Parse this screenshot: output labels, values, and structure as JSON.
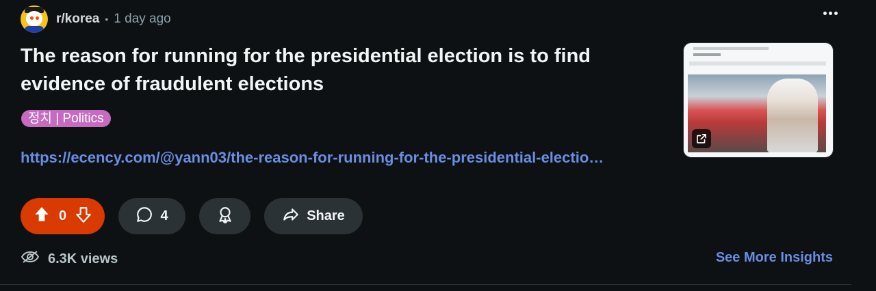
{
  "post": {
    "subreddit": "r/korea",
    "separator": "•",
    "time": "1 day ago",
    "title": "The reason for running for the presidential election is to find evidence of fraudulent elections",
    "flair": "정치 | Politics",
    "link": "https://ecency.com/@yann03/the-reason-for-running-for-the-presidential-electio…"
  },
  "actions": {
    "score": "0",
    "comments": "4",
    "share_label": "Share"
  },
  "footer": {
    "views": "6.3K views",
    "insights_label": "See More Insights"
  },
  "colors": {
    "background": "#0e1113",
    "upvote_active": "#d93a00",
    "link": "#6b8de3",
    "flair": "#c76bc0"
  },
  "icons": [
    "subreddit-avatar-icon",
    "more-options-icon",
    "upvote-icon",
    "downvote-icon",
    "comment-icon",
    "award-icon",
    "share-icon",
    "views-icon",
    "external-link-icon"
  ]
}
